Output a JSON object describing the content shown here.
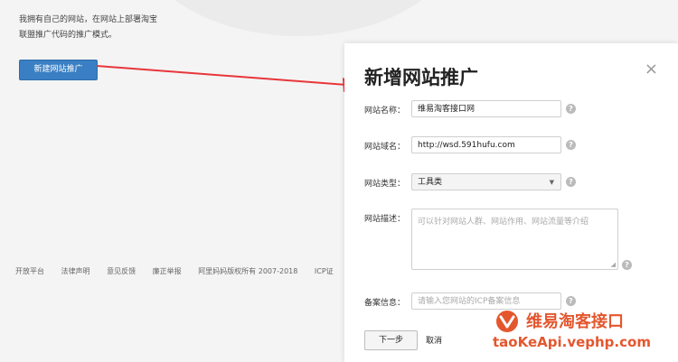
{
  "intro": {
    "line1": "我拥有自己的网站，在网站上部署淘宝",
    "line2": "联盟推广代码的推广模式。"
  },
  "new_site_button": "新建网站推广",
  "footer": {
    "links": [
      "开放平台",
      "法律声明",
      "意见反馈",
      "廉正举报"
    ],
    "copyright": "阿里妈妈版权所有 2007-2018",
    "icp": "ICP证"
  },
  "dialog": {
    "title": "新增网站推广",
    "close_icon": "×",
    "fields": {
      "name": {
        "label": "网站名称：",
        "value": "维易淘客接口网"
      },
      "domain": {
        "label": "网站域名：",
        "value": "http://wsd.591hufu.com"
      },
      "type": {
        "label": "网站类型：",
        "value": "工具类"
      },
      "desc": {
        "label": "网站描述：",
        "placeholder": "可以针对网站人群、网站作用、网站流量等介绍"
      },
      "icp": {
        "label": "备案信息：",
        "placeholder": "请输入您网站的ICP备案信息"
      }
    },
    "help_icon": "?",
    "next_button": "下一步",
    "cancel_link": "取消"
  },
  "watermark": {
    "name": "维易淘客接口",
    "url": "taoKeApi.vephp.com"
  },
  "colors": {
    "primary_button": "#3a7fc4",
    "arrow": "#e8363a",
    "watermark": "#e4572e"
  },
  "icons": [
    "close-icon",
    "help-icon",
    "chevron-down-icon",
    "resize-grip-icon",
    "watermark-logo-icon",
    "red-arrow-icon"
  ]
}
